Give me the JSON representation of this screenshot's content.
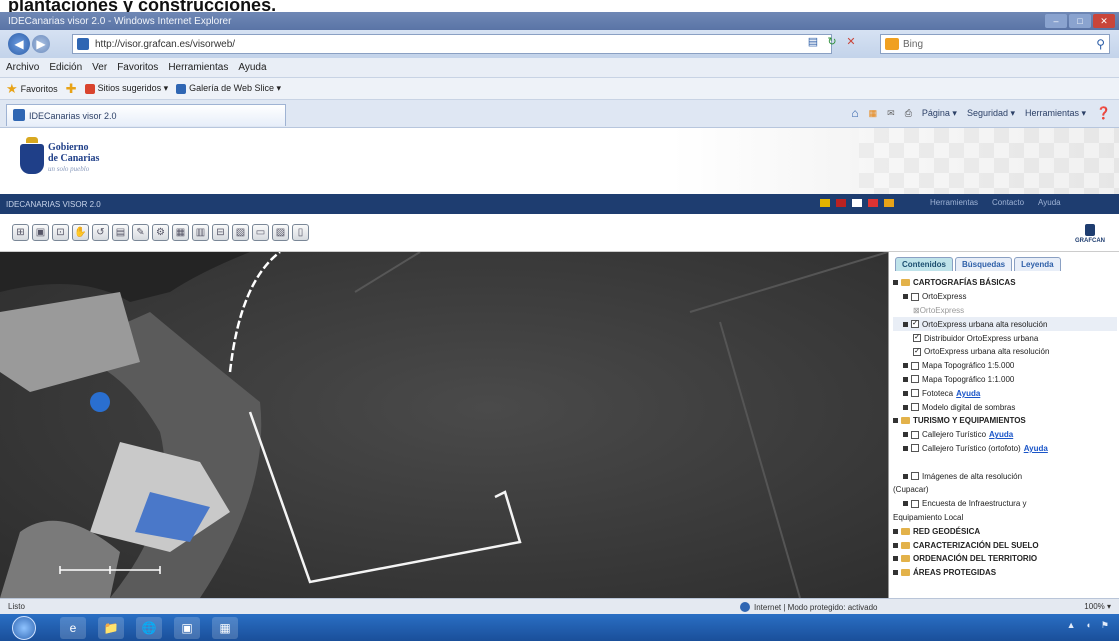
{
  "caption": "plantaciones y construcciones.",
  "window": {
    "title": "IDECanarias visor 2.0 - Windows Internet Explorer"
  },
  "address": {
    "url": "http://visor.grafcan.es/visorweb/",
    "search_placeholder": "Bing"
  },
  "menu": [
    "Archivo",
    "Edición",
    "Ver",
    "Favoritos",
    "Herramientas",
    "Ayuda"
  ],
  "favorites": {
    "label": "Favoritos",
    "items": [
      "Sitios sugeridos ▾",
      "Galería de Web Slice ▾"
    ]
  },
  "tab": {
    "title": "IDECanarias visor 2.0"
  },
  "commandbar": [
    "Página ▾",
    "Seguridad ▾",
    "Herramientas ▾"
  ],
  "brand": {
    "line1": "Gobierno",
    "line2": "de Canarias",
    "tagline": "un solo pueblo"
  },
  "appbar": {
    "left": "IDECANARIAS VISOR 2.0",
    "links": [
      "Herramientas",
      "Contacto",
      "Ayuda"
    ]
  },
  "map_tools": [
    "⊞",
    "▣",
    "⊡",
    "✋",
    "↺",
    "▤",
    "✎",
    "⚙",
    "▦",
    "▥",
    "⊟",
    "▧",
    "▭",
    "▨",
    "▯"
  ],
  "grafcan_label": "GRAFCAN",
  "panel": {
    "tabs": [
      "Contenidos",
      "Búsquedas",
      "Leyenda"
    ],
    "tree": [
      {
        "label": "CARTOGRAFÍAS BÁSICAS",
        "level": 0,
        "kind": "folder",
        "bold": true
      },
      {
        "label": "OrtoExpress",
        "level": 1,
        "kind": "check"
      },
      {
        "label": "OrtoExpress",
        "level": 2,
        "kind": "sub"
      },
      {
        "label": "OrtoExpress urbana alta resolución",
        "level": 1,
        "kind": "check_on",
        "highlight": true
      },
      {
        "label": "Distribuidor OrtoExpress urbana",
        "level": 2,
        "kind": "check_on"
      },
      {
        "label": "OrtoExpress urbana alta resolución",
        "level": 2,
        "kind": "check_on"
      },
      {
        "label": "Mapa Topográfico 1:5.000",
        "level": 1,
        "kind": "check"
      },
      {
        "label": "Mapa Topográfico 1:1.000",
        "level": 1,
        "kind": "check"
      },
      {
        "label": "Fototeca",
        "level": 1,
        "kind": "check",
        "link": "Ayuda"
      },
      {
        "label": "Modelo digital de sombras",
        "level": 1,
        "kind": "check"
      },
      {
        "label": "TURISMO Y EQUIPAMIENTOS",
        "level": 0,
        "kind": "folder",
        "bold": true
      },
      {
        "label": "Callejero Turístico",
        "level": 1,
        "kind": "check",
        "link": "Ayuda"
      },
      {
        "label": "Callejero Turístico (ortofoto)",
        "level": 1,
        "kind": "check",
        "link": "Ayuda"
      },
      {
        "label": "",
        "level": 0,
        "kind": "blank"
      },
      {
        "label": "Imágenes de alta resolución",
        "level": 1,
        "kind": "check"
      },
      {
        "label": "(Cupacar)",
        "level": 0,
        "kind": "text"
      },
      {
        "label": "Encuesta de Infraestructura y",
        "level": 1,
        "kind": "check"
      },
      {
        "label": "Equipamiento Local",
        "level": 0,
        "kind": "text"
      },
      {
        "label": "RED GEODÉSICA",
        "level": 0,
        "kind": "folder",
        "bold": true
      },
      {
        "label": "CARACTERIZACIÓN DEL SUELO",
        "level": 0,
        "kind": "folder",
        "bold": true
      },
      {
        "label": "ORDENACIÓN DEL TERRITORIO",
        "level": 0,
        "kind": "folder",
        "bold": true
      },
      {
        "label": "ÁREAS PROTEGIDAS",
        "level": 0,
        "kind": "folder",
        "bold": true
      }
    ]
  },
  "status": {
    "left": "Listo",
    "zone": "Internet | Modo protegido: activado",
    "zoom": "100% ▾"
  },
  "taskbar": {
    "icons": [
      "e",
      "📁",
      "🌐",
      "▣",
      "▦"
    ]
  }
}
